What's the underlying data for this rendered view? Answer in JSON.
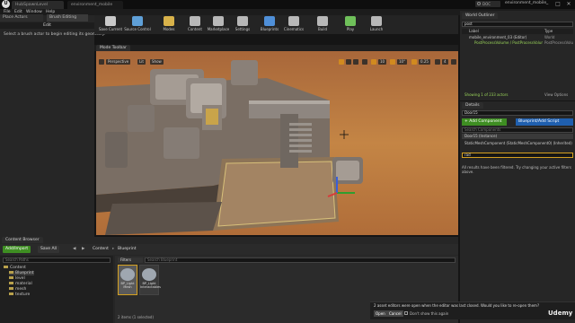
{
  "titlebar": {
    "tab1": "HubSpawnLevel",
    "tab2": "environment_mobile",
    "search": "DOC",
    "project": "environment_mobile"
  },
  "menu": [
    "File",
    "Edit",
    "Window",
    "Help"
  ],
  "modes": {
    "tab": "Modes",
    "place": "Place Actors",
    "brush": "Brush Editing",
    "edit": "Edit",
    "hint": "Select a brush actor to begin editing its geometry."
  },
  "toolbar": {
    "items": [
      "Save Current",
      "Source Control",
      "Modes",
      "Content",
      "Marketplace",
      "Settings",
      "Blueprints",
      "Cinematics",
      "Build",
      "Play",
      "Launch"
    ]
  },
  "viewport": {
    "tab": "Mode Toolbar",
    "perspective": "Perspective",
    "lit": "Lit",
    "show": "Show",
    "move": "10",
    "rotate": "10°",
    "scale": "0.25",
    "camera": "4"
  },
  "content_browser": {
    "tab": "Content Browser",
    "add": "Add/Import",
    "save": "Save All",
    "path_root": "Content",
    "path_current": "Blueprint",
    "filters": "Filters",
    "search_placeholder": "Search Blueprint",
    "search_paths": "Search Paths",
    "tree": [
      "Content",
      "Blueprint",
      "level",
      "material",
      "mesh",
      "texture"
    ],
    "assets": [
      {
        "name": "BP_Light Mesh"
      },
      {
        "name": "BP_Light Interactables"
      }
    ],
    "status": "2 items (1 selected)",
    "view_options": "View Options"
  },
  "outliner": {
    "tab": "World Outliner",
    "search": "post",
    "col_label": "Label",
    "col_type": "Type",
    "rows": [
      {
        "label": "mobile_environment_03 (Editor)",
        "type": "World"
      },
      {
        "label": "PostProcessVolume / PostProcessVolume",
        "type": "PostProcessVolume"
      }
    ],
    "count": "Showing 1 of 233 actors",
    "view_options": "View Options"
  },
  "details": {
    "tab": "Details",
    "name": "Door15",
    "add_component": "+ Add Component",
    "blueprint": "Blueprint/Add Script",
    "search_placeholder": "Search Components",
    "root": "Door15 (Instance)",
    "component": "StaticMeshComponent (StaticMeshComponent0) (Inherited)",
    "filter": "rad",
    "filter_note": "All results have been filtered. Try changing your active filters above."
  },
  "notification": {
    "text": "2 asset editors were open when the editor was last closed. Would you like to re-open them?",
    "open": "Open",
    "cancel": "Cancel",
    "dont_show": "Don't show this again",
    "watermark": "Udemy"
  },
  "colors": {
    "accent_green": "#3e8e22",
    "accent_blue": "#1f5fae",
    "selection": "#d4a020",
    "sand": "#c08040"
  }
}
